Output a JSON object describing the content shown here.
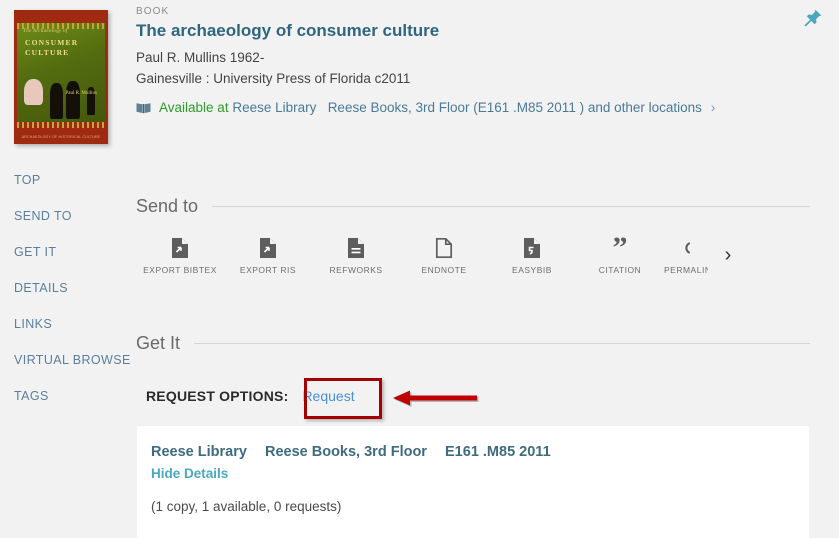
{
  "record": {
    "type_label": "BOOK",
    "title": "The archaeology of consumer culture",
    "author": "Paul R. Mullins 1962-",
    "publication": "Gainesville : University Press of Florida c2011",
    "availability": {
      "icon": "book-icon",
      "status": "Available at",
      "library": "Reese Library",
      "location": "Reese Books, 3rd Floor (E161 .M85 2011 )",
      "more": "and other locations",
      "chevron": "›"
    },
    "pin_icon": "pushpin-icon",
    "cover": {
      "title_small": "The Archaeology of",
      "title_large": "CONSUMER CULTURE",
      "author": "Paul R. Mullins",
      "footer": "ARCHAEOLOGY OF HISTORICAL CULTURE"
    }
  },
  "side_nav": {
    "items": [
      {
        "label": "TOP",
        "key": "top"
      },
      {
        "label": "SEND TO",
        "key": "send-to"
      },
      {
        "label": "GET IT",
        "key": "get-it"
      },
      {
        "label": "DETAILS",
        "key": "details"
      },
      {
        "label": "LINKS",
        "key": "links"
      },
      {
        "label": "VIRTUAL BROWSE",
        "key": "virtual-browse"
      },
      {
        "label": "TAGS",
        "key": "tags"
      }
    ]
  },
  "send_to": {
    "heading": "Send to",
    "next_arrow": "›",
    "actions": [
      {
        "label": "EXPORT BIBTEX",
        "icon": "document-export-icon"
      },
      {
        "label": "EXPORT RIS",
        "icon": "document-export-icon"
      },
      {
        "label": "REFWORKS",
        "icon": "document-lines-icon"
      },
      {
        "label": "ENDNOTE",
        "icon": "document-outline-icon"
      },
      {
        "label": "EASYBIB",
        "icon": "document-quote-icon"
      },
      {
        "label": "CITATION",
        "icon": "quote-icon"
      },
      {
        "label": "PERMALINK",
        "icon": "link-icon"
      }
    ]
  },
  "get_it": {
    "heading": "Get It",
    "request_options_label": "REQUEST OPTIONS:",
    "request_link": "Request",
    "holdings": {
      "library": "Reese Library",
      "location": "Reese Books, 3rd Floor",
      "call_number": "E161 .M85 2011",
      "toggle_label": "Hide Details",
      "counts": "(1 copy, 1 available, 0 requests)"
    }
  },
  "colors": {
    "background": "#f2f2f2",
    "title": "#2e667f",
    "link": "#4a7a96",
    "available": "#2d9c2d",
    "request_link": "#4a90d9",
    "annotation": "#a50000",
    "teal": "#4aa8bd",
    "panel": "#ffffff"
  }
}
